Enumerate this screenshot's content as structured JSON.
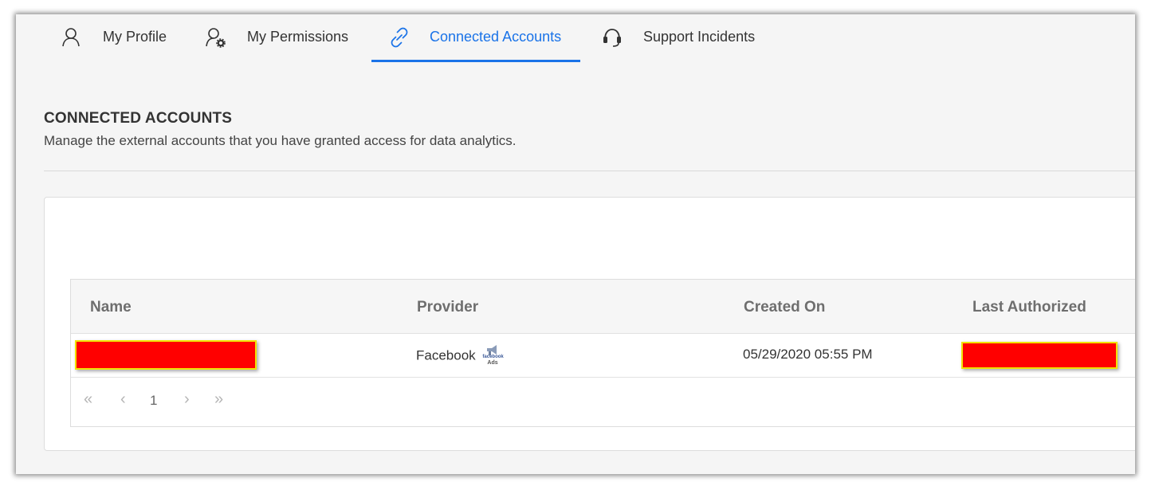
{
  "tabs": [
    {
      "label": "My Profile",
      "icon": "user-icon"
    },
    {
      "label": "My Permissions",
      "icon": "user-gear-icon"
    },
    {
      "label": "Connected Accounts",
      "icon": "link-icon",
      "active": true
    },
    {
      "label": "Support Incidents",
      "icon": "headset-icon"
    }
  ],
  "section": {
    "title": "CONNECTED ACCOUNTS",
    "description": "Manage the external accounts that you have granted access for data analytics."
  },
  "table": {
    "columns": [
      "Name",
      "Provider",
      "Created On",
      "Last Authorized"
    ],
    "rows": [
      {
        "name": "",
        "provider": "Facebook",
        "provider_badge_top": "facebook",
        "provider_badge_bottom": "Ads",
        "created_on": "05/29/2020 05:55 PM",
        "last_authorized": ""
      }
    ]
  },
  "pager": {
    "first": "«",
    "prev": "‹",
    "page": "1",
    "next": "›",
    "last": "»"
  },
  "colors": {
    "accent": "#1a73e8",
    "redaction": "#ff0000",
    "redaction_border": "#f2e200"
  }
}
